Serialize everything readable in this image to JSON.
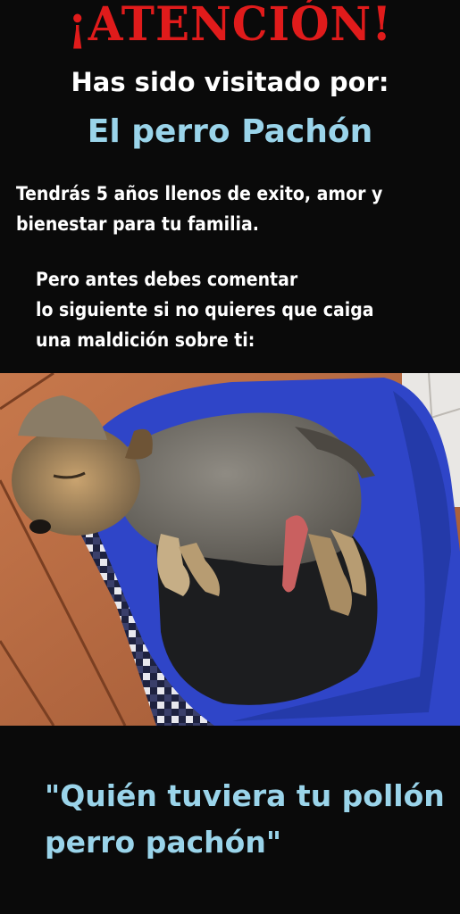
{
  "header": {
    "title": "¡ATENCIÓN!",
    "subtitle": "Has sido visitado por:",
    "dog_name": "El perro Pachón"
  },
  "message": {
    "paragraph1_lines": [
      "Tendrás 5 años llenos de exito, amor y",
      "bienestar para tu familia."
    ],
    "paragraph2_lines": [
      "Pero antes debes comentar",
      "lo siguiente si no quieres que caiga",
      "una maldición sobre ti:"
    ]
  },
  "quote": {
    "lines": [
      "\"Quién tuviera tu pollón",
      "perro pachón\""
    ]
  },
  "colors": {
    "background": "#0a0a0a",
    "title_red": "#e01b1b",
    "text_white": "#ffffff",
    "accent_blue": "#9ad4ea"
  }
}
